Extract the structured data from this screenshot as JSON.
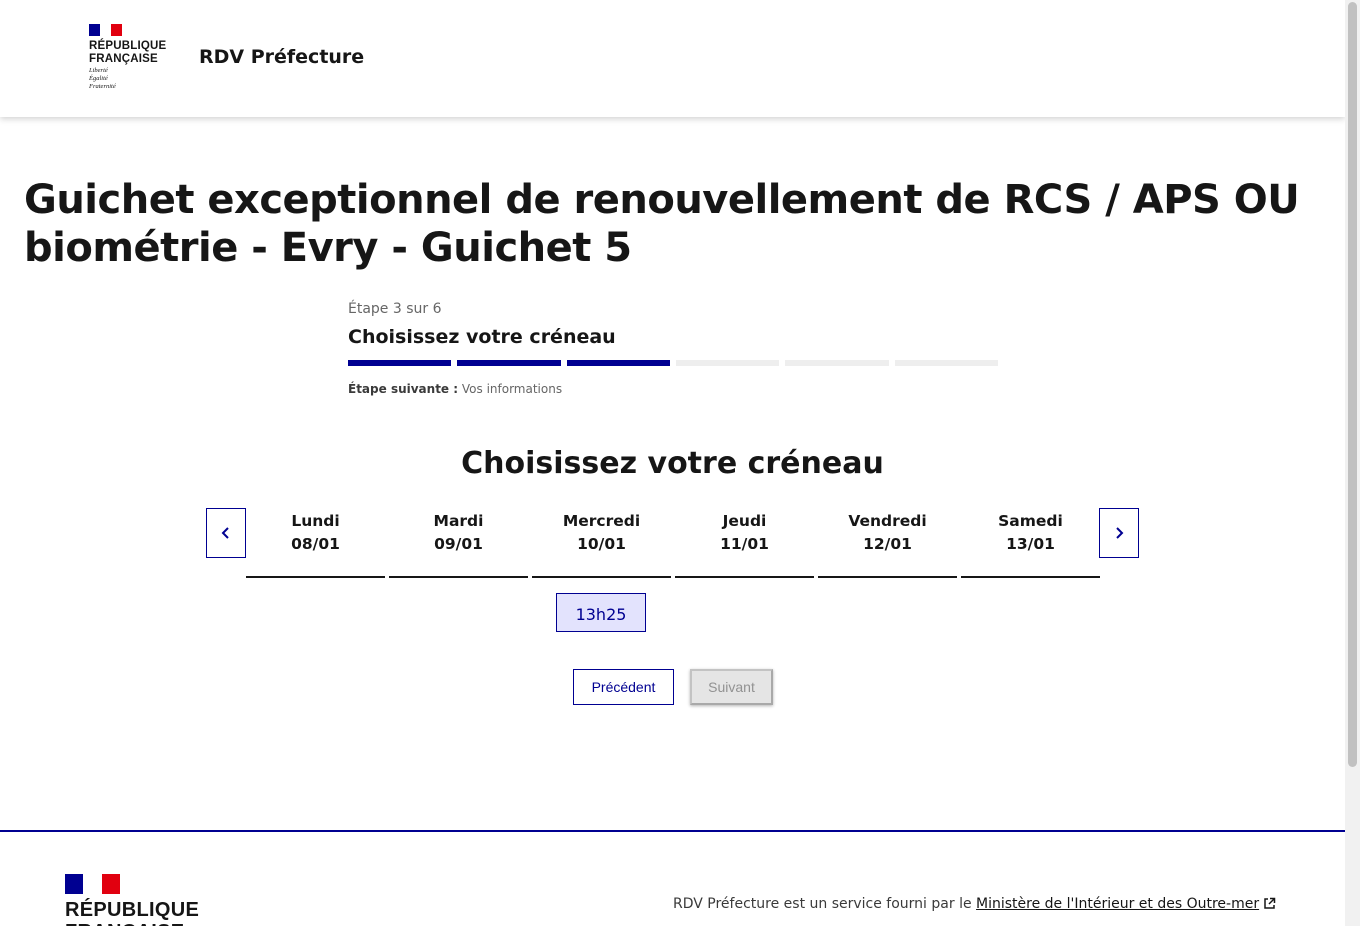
{
  "header": {
    "logo_text": "RÉPUBLIQUE\nFRANÇAISE",
    "devise": "Liberté\nÉgalité\nFraternité",
    "service_title": "RDV Préfecture"
  },
  "page": {
    "title": "Guichet exceptionnel de renouvellement de RCS / APS OU biométrie - Evry - Guichet 5"
  },
  "stepper": {
    "state": "Étape 3 sur 6",
    "title": "Choisissez votre créneau",
    "current_step": 3,
    "total_steps": 6,
    "next_label": "Étape suivante :",
    "next_value": "Vos informations"
  },
  "picker": {
    "title": "Choisissez votre créneau",
    "prev_icon": "chevron-left-icon",
    "next_icon": "chevron-right-icon",
    "days": [
      {
        "name": "Lundi",
        "date": "08/01"
      },
      {
        "name": "Mardi",
        "date": "09/01"
      },
      {
        "name": "Mercredi",
        "date": "10/01"
      },
      {
        "name": "Jeudi",
        "date": "11/01"
      },
      {
        "name": "Vendredi",
        "date": "12/01"
      },
      {
        "name": "Samedi",
        "date": "13/01"
      }
    ],
    "slots": [
      {
        "day": "Mercredi 10/01",
        "time": "13h25"
      }
    ]
  },
  "actions": {
    "previous_label": "Précédent",
    "next_label": "Suivant",
    "next_disabled": true
  },
  "footer": {
    "logo_text": "RÉPUBLIQUE\nFRANÇAISE",
    "description": "RDV Préfecture est un service fourni par le ",
    "link_text": "Ministère de l'Intérieur et des Outre-mer",
    "link_icon": "external-link-icon"
  },
  "colors": {
    "primary": "#000091",
    "flag_red": "#e1000f",
    "slot_bg": "#e3e3fd",
    "text": "#161616"
  }
}
